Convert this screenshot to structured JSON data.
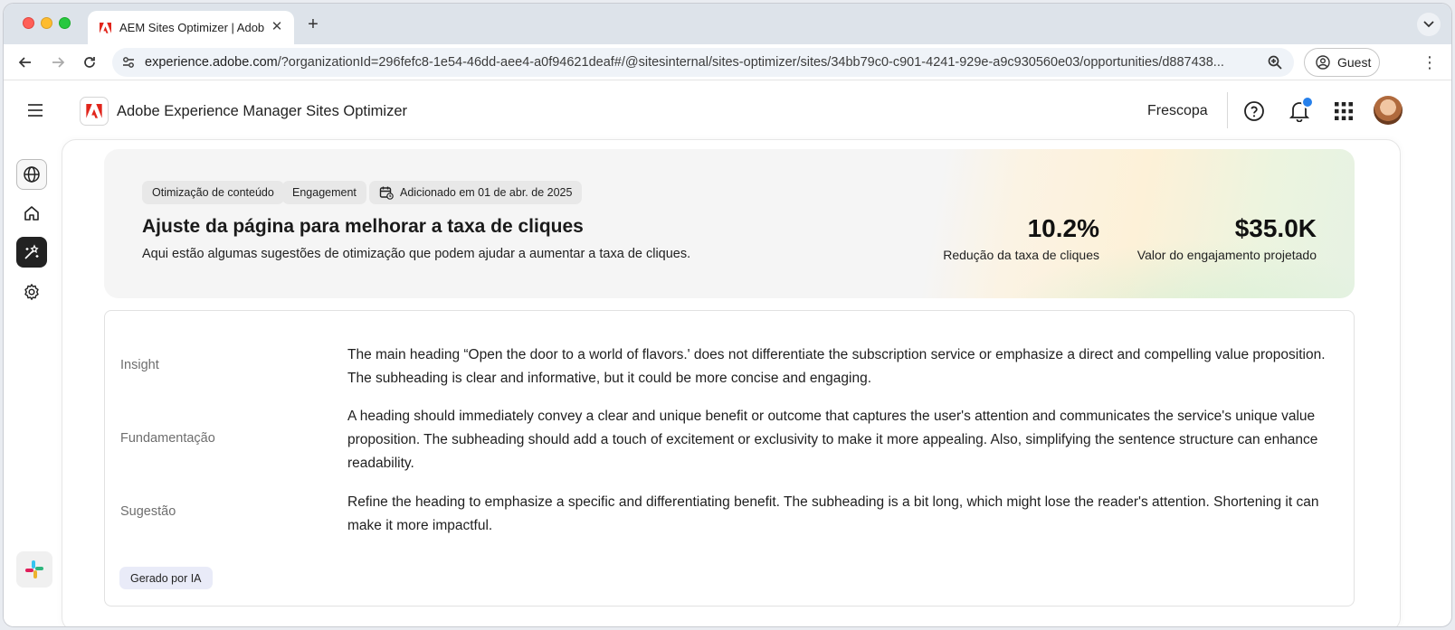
{
  "browser": {
    "tab_title": "AEM Sites Optimizer | Adobe",
    "url_host": "experience.adobe.com",
    "url_rest": "/?organizationId=296fefc8-1e54-46dd-aee4-a0f94621deaf#/@sitesinternal/sites-optimizer/sites/34bb79c0-c901-4241-929e-a9c930560e03/opportunities/d887438...",
    "guest_label": "Guest"
  },
  "header": {
    "app_name": "Adobe Experience Manager Sites Optimizer",
    "org_name": "Frescopa"
  },
  "opportunity": {
    "tags": [
      "Otimização de conteúdo",
      "Engagement"
    ],
    "added_date": "Adicionado em 01 de abr. de 2025",
    "title": "Ajuste da página para melhorar a taxa de cliques",
    "description": "Aqui estão algumas sugestões de otimização que podem ajudar a aumentar a taxa de cliques.",
    "metrics": [
      {
        "value": "10.2%",
        "label": "Redução da taxa de cliques"
      },
      {
        "value": "$35.0K",
        "label": "Valor do engajamento projetado"
      }
    ]
  },
  "details": {
    "rows": [
      {
        "label": "Insight",
        "text": "The main heading “Open the door to a world of flavors.' does not differentiate the subscription service or emphasize a direct and compelling value proposition. The subheading is clear and informative, but it could be more concise and engaging."
      },
      {
        "label": "Fundamentação",
        "text": "A heading should immediately convey a clear and unique benefit or outcome that captures the user's attention and communicates the service's unique value proposition. The subheading should add a touch of excitement or exclusivity to make it more appealing. Also, simplifying the sentence structure can enhance readability."
      },
      {
        "label": "Sugestão",
        "text": "Refine the heading to emphasize a specific and differentiating benefit. The subheading is a bit long, which might lose the reader's attention. Shortening it can make it more impactful."
      }
    ],
    "ai_badge": "Gerado por IA"
  },
  "colors": {
    "accent_red": "#e1251b",
    "notification_blue": "#2680eb"
  }
}
